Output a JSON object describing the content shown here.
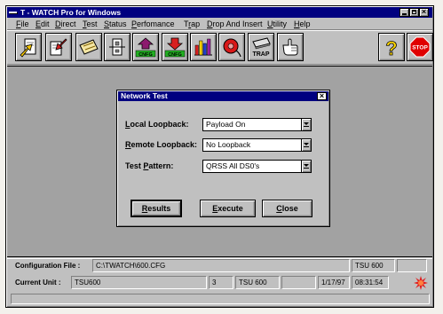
{
  "window": {
    "title": "T - WATCH Pro for Windows"
  },
  "menu": {
    "items": [
      "File",
      "Edit",
      "Direct",
      "Test",
      "Status",
      "Perfomance",
      "Trap",
      "Drop And Insert",
      "Utility",
      "Help"
    ]
  },
  "toolbar": {
    "icons": [
      "open-file-icon",
      "save-file-icon",
      "tape-card-icon",
      "unit-icon",
      "config-upload-icon",
      "config-download-icon",
      "performance-chart-icon",
      "dial-icon",
      "trap-icon",
      "pointing-hand-icon",
      "help-icon",
      "stop-icon"
    ],
    "config_upload_tag": "CNFG",
    "config_download_tag": "CNFG",
    "trap_label": "TRAP",
    "help_label": "?",
    "stop_label": "STOP"
  },
  "dialog": {
    "title": "Network Test",
    "fields": [
      {
        "label": "Local Loopback:",
        "value": "Payload On"
      },
      {
        "label": "Remote Loopback:",
        "value": "No Loopback"
      },
      {
        "label": "Test Pattern:",
        "value": "QRSS All DS0's"
      }
    ],
    "buttons": {
      "results": "Results",
      "execute": "Execute",
      "close": "Close"
    }
  },
  "status": {
    "config_file_label": "Configuration File :",
    "config_file": "C:\\TWATCH\\600.CFG",
    "config_unit": "TSU 600",
    "current_unit_label": "Current Unit :",
    "current_unit": "TSU600",
    "unit_number": "3",
    "unit_model": "TSU 600",
    "date": "1/17/97",
    "time": "08:31:54"
  },
  "colors": {
    "title": "#000080",
    "face": "#c0c0c0",
    "workspace": "#a2a2a2",
    "alarm": "#e02020"
  }
}
